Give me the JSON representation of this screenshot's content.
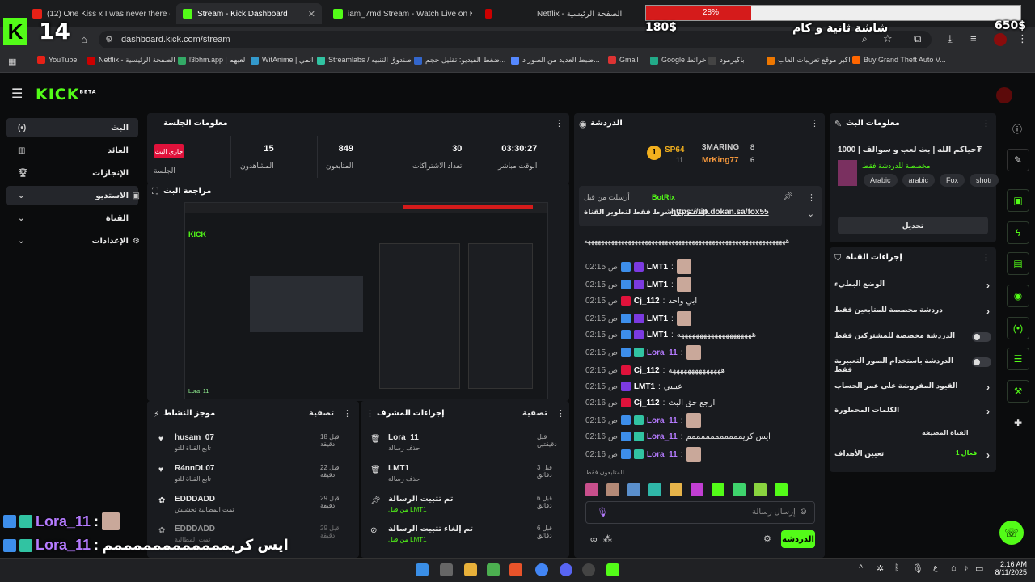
{
  "browser": {
    "tabs": [
      {
        "title": "(12) One Kiss x I was never there - You",
        "active": false
      },
      {
        "title": "Stream - Kick Dashboard",
        "active": true
      },
      {
        "title": "iam_7md Stream - Watch Live on Kick",
        "active": false
      },
      {
        "title": "Netflix - الصفحة الرئيسية",
        "active": false
      }
    ],
    "url": "dashboard.kick.com/stream",
    "bookmarks": [
      "YouTube",
      "Netflix - الصفحة الرئيسية",
      "l3bhm.app | لعبهم",
      "WitAnime | انمي",
      "Streamlabs / صندوق التنبيه",
      "ضغط الفيديو: تقليل حجم...",
      "ضبط العديد من الصور د...",
      "Gmail",
      "Google خرائط",
      "باكيرمود",
      "اكبر موقع تعريبات العاب -...",
      "Buy Grand Theft Auto V..."
    ]
  },
  "overlay": {
    "tab_count": "14",
    "goal_percent_label": "28%",
    "goal_fraction": 0.28,
    "goal_amount": "650$",
    "current_amount": "180$",
    "goal_text": "شاشة ثانية و كام",
    "chat_user": "Lora_11",
    "chat_message": "ايس كريممممممممممممم"
  },
  "kick": {
    "logo": "KICK",
    "logo_tag": "BETA",
    "nav": [
      "البث",
      "العائد",
      "الإنجازات",
      "الاستديو",
      "القناة",
      "الإعدادات"
    ],
    "session": {
      "title": "معلومات الجلسة",
      "live_badge": "جاري البث",
      "live_label": "الجلسة",
      "stats": [
        {
          "value": "15",
          "label": "المشاهدون"
        },
        {
          "value": "849",
          "label": "المتابعون"
        },
        {
          "value": "30",
          "label": "تعداد الاشتراكات"
        },
        {
          "value": "03:30:27",
          "label": "الوقت مباشر"
        }
      ]
    },
    "preview_title": "مراجعة البث",
    "preview_user": "Lora_11",
    "activity": {
      "title": "موجز النشاط",
      "filter": "تصفية",
      "items": [
        {
          "user": "husam_07",
          "desc": "تابع القناة للتو",
          "time": "قبل 18 دقيقة"
        },
        {
          "user": "R4nnDL07",
          "desc": "تابع القناة للتو",
          "time": "قبل 22 دقيقة"
        },
        {
          "user": "EDDDADD",
          "desc": "تمت المطالبة تحشيش",
          "time": "قبل 29 دقيقة"
        },
        {
          "user": "EDDDADD",
          "desc": "تمت المطالبة",
          "time": "قبل 29 دقيقة"
        }
      ]
    },
    "mod": {
      "title": "إجراءات المشرف",
      "filter": "تصفية",
      "items": [
        {
          "title": "Lora_11",
          "desc": "حذف رسالة",
          "time": "قبل دقيقتين"
        },
        {
          "title": "LMT1",
          "desc": "حذف رسالة",
          "time": "قبل 3 دقائق"
        },
        {
          "title": "تم تثبيت الرسالة",
          "desc": "من قبل LMT1",
          "time": "قبل 6 دقائق"
        },
        {
          "title": "تم إلغاء تثبيت الرسالة",
          "desc": "من قبل LMT1",
          "time": "قبل 6 دقائق"
        }
      ]
    },
    "chat": {
      "title": "الدردشة",
      "leaders": [
        {
          "name": "SP64",
          "count": "11"
        },
        {
          "name": "3MARING",
          "count": "8"
        },
        {
          "name": "MrKing77",
          "count": "6"
        }
      ],
      "pinned_by": "أرسلت من قبل",
      "pinned_user": "BotRix",
      "pinned_text": "الدعم من شرط فقط لتطوير القناة",
      "pinned_link": "https://tip.dokan.sa/fox55",
      "lines": [
        {
          "time": "02:15 ص",
          "user": "LMT1",
          "msg": ""
        },
        {
          "time": "02:15 ص",
          "user": "LMT1",
          "msg": ""
        },
        {
          "time": "02:15 ص",
          "user": "Cj_112",
          "msg": "ابي واحد"
        },
        {
          "time": "02:15 ص",
          "user": "LMT1",
          "msg": ""
        },
        {
          "time": "02:15 ص",
          "user": "LMT1",
          "msg": "ههههههههههههههههههههه"
        },
        {
          "time": "02:15 ص",
          "user": "Lora_11",
          "msg": ""
        },
        {
          "time": "02:15 ص",
          "user": "Cj_112",
          "msg": "ههههههههههههههه"
        },
        {
          "time": "02:15 ص",
          "user": "LMT1",
          "msg": "عيييي"
        },
        {
          "time": "02:16 ص",
          "user": "Cj_112",
          "msg": "ارجع حق البث"
        },
        {
          "time": "02:16 ص",
          "user": "Lora_11",
          "msg": ""
        },
        {
          "time": "02:16 ص",
          "user": "Lora_11",
          "msg": "ايس كريمممممممممممم"
        },
        {
          "time": "02:16 ص",
          "user": "Lora_11",
          "msg": ""
        }
      ],
      "followers_only": "المتابعون فقط",
      "input_placeholder": "إرسال رسالة",
      "send_label": "الدردشة"
    },
    "stream_info": {
      "title": "معلومات البث",
      "stream_title": "حياكم الله | بث لعب و سوالف | 1000₮",
      "category": "مخصصة للدردشة فقط",
      "tags": [
        "Arabic",
        "arabic",
        "Fox",
        "shotr"
      ],
      "edit_label": "تحديل"
    },
    "channel_actions": {
      "title": "إجراءات القناة",
      "items": [
        "الوضع البطيء",
        "دردشة مخصصة للمتابعين فقط",
        "الدردشة مخصصة للمشتركين فقط",
        "الدردشة باستخدام الصور التعبيرية فقط",
        "القيود المفروضة على عمر الحساب",
        "الكلمات المحظورة"
      ],
      "goal_section": "القناة المضيفة",
      "goal_label": "تعيين الأهداف",
      "goal_value": "فعال 1"
    }
  },
  "taskbar": {
    "time": "2:16 AM",
    "date": "8/11/2025"
  }
}
